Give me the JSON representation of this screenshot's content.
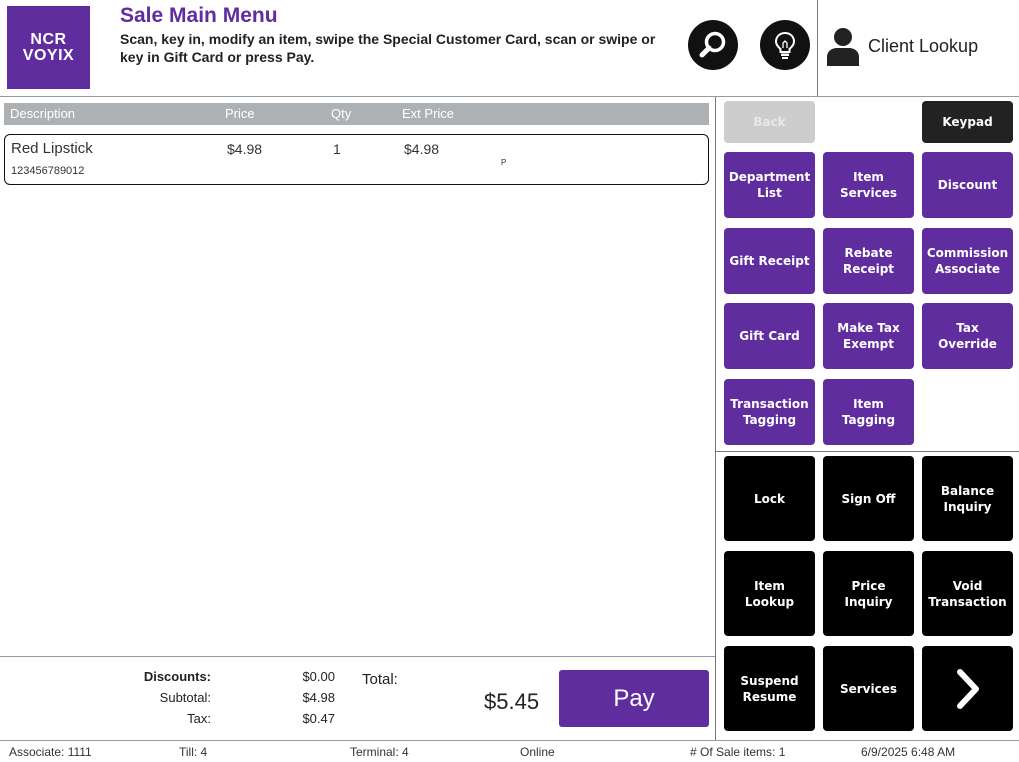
{
  "header": {
    "logo_line1": "NCR",
    "logo_line2": "VOYIX",
    "title": "Sale Main Menu",
    "instructions": "Scan, key in, modify an item, swipe the Special Customer Card, scan or swipe or key in Gift Card or press Pay.",
    "client_label": "Client Lookup"
  },
  "columns": {
    "description": "Description",
    "price": "Price",
    "qty": "Qty",
    "ext_price": "Ext Price"
  },
  "items": [
    {
      "description": "Red Lipstick",
      "sku": "123456789012",
      "price": "$4.98",
      "qty": "1",
      "ext_price": "$4.98",
      "flag": "P"
    }
  ],
  "totals": {
    "discounts_label": "Discounts:",
    "discounts": "$0.00",
    "subtotal_label": "Subtotal:",
    "subtotal": "$4.98",
    "tax_label": "Tax:",
    "tax": "$0.47",
    "total_label": "Total:",
    "total": "$5.45",
    "pay_label": "Pay"
  },
  "buttons": {
    "back": "Back",
    "keypad": "Keypad",
    "department_list": "Department List",
    "item_services": "Item Services",
    "discount": "Discount",
    "gift_receipt": "Gift Receipt",
    "rebate_receipt": "Rebate Receipt",
    "commission_associate": "Commission Associate",
    "gift_card": "Gift Card",
    "make_tax_exempt": "Make Tax Exempt",
    "tax_override": "Tax Override",
    "transaction_tagging": "Transaction Tagging",
    "item_tagging": "Item Tagging",
    "lock": "Lock",
    "sign_off": "Sign Off",
    "balance_inquiry": "Balance Inquiry",
    "item_lookup": "Item Lookup",
    "price_inquiry": "Price Inquiry",
    "void_transaction": "Void Transaction",
    "suspend_resume": "Suspend Resume",
    "services": "Services"
  },
  "status": {
    "associate": "Associate: 1111",
    "till": "Till: 4",
    "terminal": "Terminal: 4",
    "connection": "Online",
    "sale_items": "# Of Sale items: 1",
    "datetime": "6/9/2025 6:48 AM"
  },
  "colors": {
    "brand_purple": "#5f2d9e",
    "button_black": "#000000",
    "header_gray": "#aeb1b4"
  },
  "icons": [
    "search-icon",
    "lightbulb-icon",
    "user-icon",
    "chevron-right-icon"
  ]
}
